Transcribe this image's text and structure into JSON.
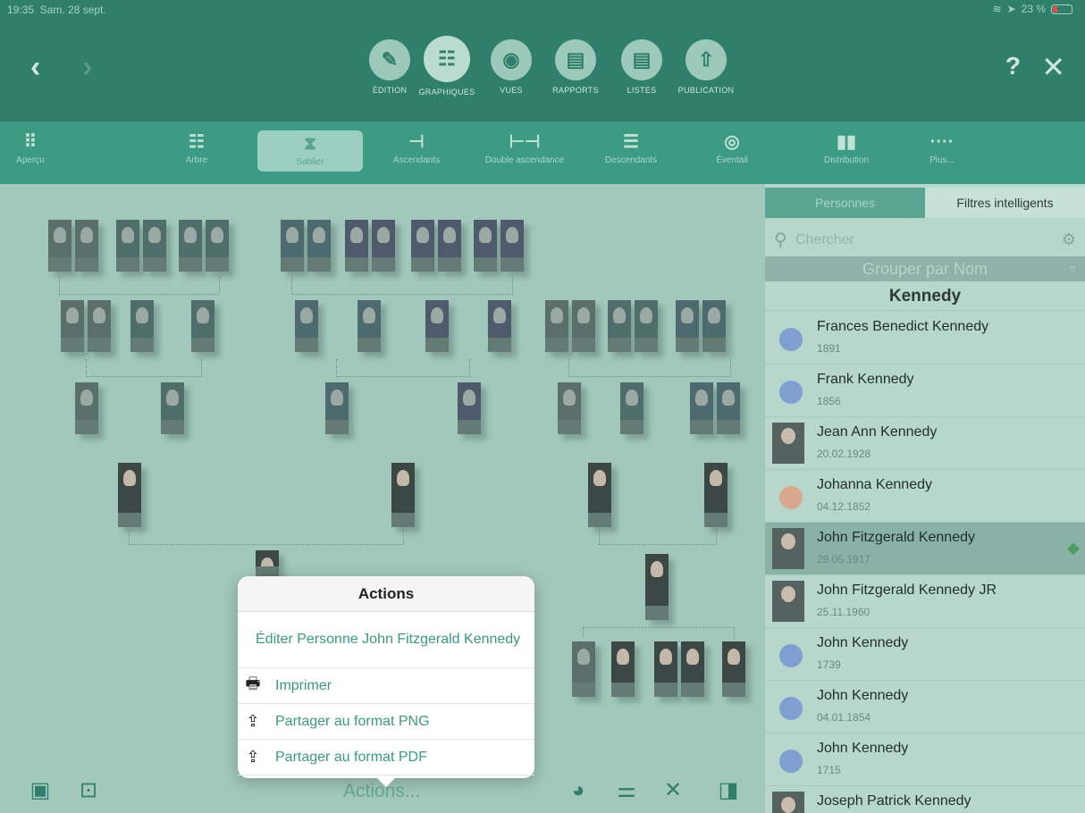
{
  "status": {
    "time": "19:35",
    "date": "Sam. 28 sept.",
    "battery": "23 %"
  },
  "modes": [
    {
      "label": "ÉDITION",
      "icon": "pencil-icon"
    },
    {
      "label": "GRAPHIQUES",
      "icon": "chart-icon"
    },
    {
      "label": "VUES",
      "icon": "eye-icon"
    },
    {
      "label": "RAPPORTS",
      "icon": "report-icon"
    },
    {
      "label": "LISTES",
      "icon": "list-icon"
    },
    {
      "label": "PUBLICATION",
      "icon": "publish-icon"
    }
  ],
  "help_label": "?",
  "chart_types": [
    {
      "label": "Aperçu",
      "icon": "grid-icon"
    },
    {
      "label": "Arbre",
      "icon": "tree-icon"
    },
    {
      "label": "Sablier",
      "icon": "hourglass-icon"
    },
    {
      "label": "Ascendants",
      "icon": "ancestors-icon"
    },
    {
      "label": "Double ascendance",
      "icon": "double-ancestry-icon"
    },
    {
      "label": "Descendants",
      "icon": "descendants-icon"
    },
    {
      "label": "Éventail",
      "icon": "fan-icon"
    },
    {
      "label": "Distribution",
      "icon": "distribution-icon"
    },
    {
      "label": "Plus...",
      "icon": "more-icon"
    }
  ],
  "panel": {
    "tab_persons": "Personnes",
    "tab_filters": "Filtres intelligents",
    "search_placeholder": "Chercher",
    "group_by": "Grouper par Nom",
    "group_name": "Kennedy",
    "persons": [
      {
        "name": "Frances Benedict Kennedy",
        "date": "1891",
        "kind": "dot",
        "color": "#7f9fd0"
      },
      {
        "name": "Frank Kennedy",
        "date": "1856",
        "kind": "dot",
        "color": "#7f9fd0"
      },
      {
        "name": "Jean Ann Kennedy",
        "date": "20.02.1928",
        "kind": "photo",
        "color": ""
      },
      {
        "name": "Johanna Kennedy",
        "date": "04.12.1852",
        "kind": "dot",
        "color": "#d8a88e"
      },
      {
        "name": "John Fitzgerald Kennedy",
        "date": "29.05.1917",
        "kind": "photo",
        "color": "",
        "selected": true
      },
      {
        "name": "John Fitzgerald Kennedy JR",
        "date": "25.11.1960",
        "kind": "photo",
        "color": ""
      },
      {
        "name": "John Kennedy",
        "date": "1739",
        "kind": "dot",
        "color": "#7f9fd0"
      },
      {
        "name": "John Kennedy",
        "date": "04.01.1854",
        "kind": "dot",
        "color": "#7f9fd0"
      },
      {
        "name": "John Kennedy",
        "date": "1715",
        "kind": "dot",
        "color": "#7f9fd0"
      },
      {
        "name": "Joseph Patrick Kennedy",
        "date": "",
        "kind": "photo",
        "color": ""
      }
    ]
  },
  "popover": {
    "title": "Actions",
    "edit": "Éditer Personne John Fitzgerald Kennedy",
    "print": "Imprimer",
    "share_png": "Partager au format PNG",
    "share_pdf": "Partager au format PDF"
  },
  "bottom": {
    "actions_label": "Actions..."
  }
}
